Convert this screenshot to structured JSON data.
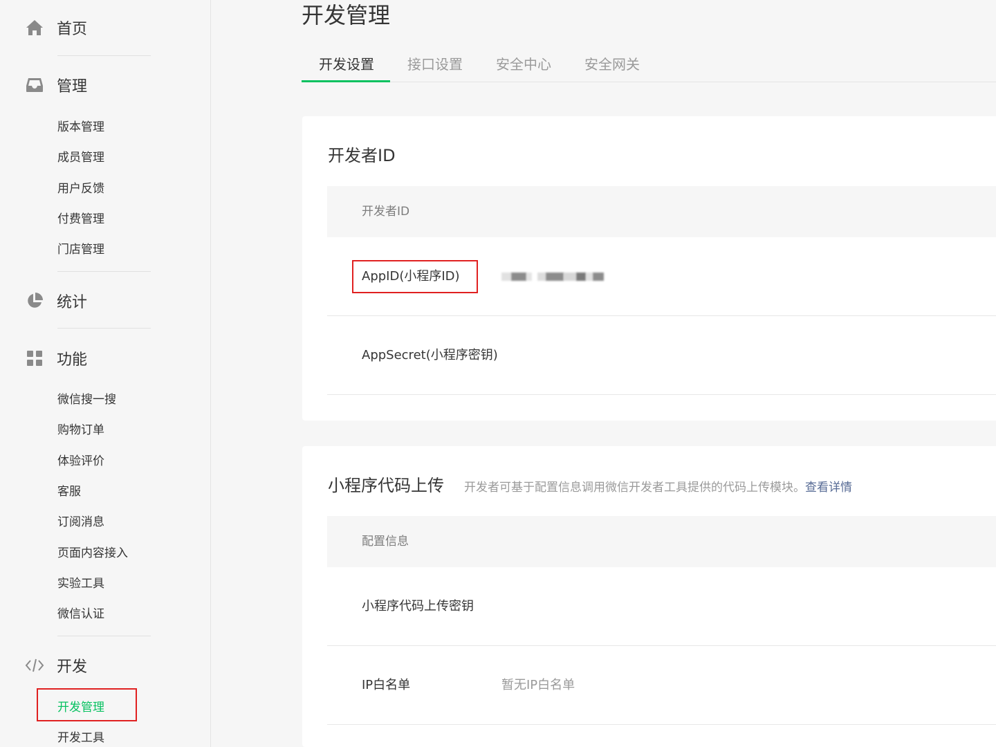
{
  "sidebar": {
    "home": {
      "label": "首页",
      "icon": "home-icon"
    },
    "manage": {
      "label": "管理",
      "icon": "inbox-icon",
      "items": [
        "版本管理",
        "成员管理",
        "用户反馈",
        "付费管理",
        "门店管理"
      ]
    },
    "stats": {
      "label": "统计",
      "icon": "pie-chart-icon"
    },
    "features": {
      "label": "功能",
      "icon": "grid-icon",
      "items": [
        "微信搜一搜",
        "购物订单",
        "体验评价",
        "客服",
        "订阅消息",
        "页面内容接入",
        "实验工具",
        "微信认证"
      ]
    },
    "develop": {
      "label": "开发",
      "icon": "code-icon",
      "items": [
        "开发管理",
        "开发工具"
      ],
      "active_item": "开发管理"
    }
  },
  "main": {
    "title": "开发管理",
    "tabs": [
      "开发设置",
      "接口设置",
      "安全中心",
      "安全网关"
    ],
    "active_tab": "开发设置",
    "developer_id_card": {
      "title": "开发者ID",
      "table_header": "开发者ID",
      "rows": [
        {
          "label": "AppID(小程序ID)",
          "value": ""
        },
        {
          "label": "AppSecret(小程序密钥)",
          "value": ""
        }
      ]
    },
    "upload_card": {
      "title": "小程序代码上传",
      "description": "开发者可基于配置信息调用微信开发者工具提供的代码上传模块。",
      "description_link": "查看详情",
      "table_header": "配置信息",
      "rows": [
        {
          "label": "小程序代码上传密钥",
          "value": ""
        },
        {
          "label": "IP白名单",
          "value": "暂无IP白名单"
        }
      ]
    }
  },
  "colors": {
    "accent": "#07c160",
    "annotation": "#e02020",
    "link": "#576b95"
  }
}
